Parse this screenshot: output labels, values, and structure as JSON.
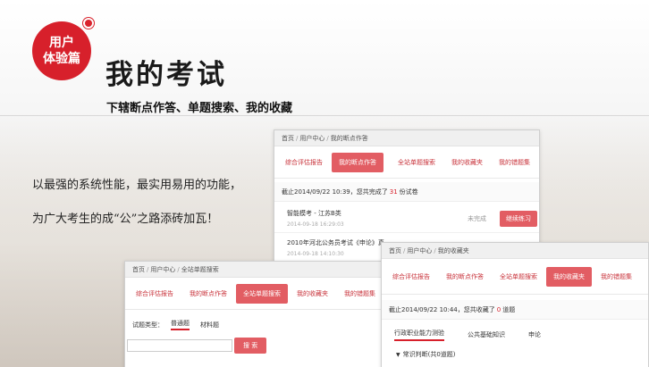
{
  "header": {
    "badge_line1": "用户",
    "badge_line2": "体验篇",
    "title": "我的考试",
    "subtitle": "下辖断点作答、单题搜索、我的收藏"
  },
  "slogan": {
    "line1": "以最强的系统性能，最实用易用的功能，",
    "line2": "为广大考生的成“公”之路添砖加瓦！"
  },
  "panel_breakpoint": {
    "breadcrumb": [
      "首页",
      "用户中心",
      "我的断点作答"
    ],
    "tabs": [
      "综合评估报告",
      "我的断点作答",
      "全站单题搜索",
      "我的收藏夹",
      "我的错题集"
    ],
    "active_tab": 1,
    "summary_prefix": "截止2014/09/22 10:39，您共完成了",
    "summary_count": "31",
    "summary_suffix": "份试卷",
    "exams": [
      {
        "name": "智能模考 - 江苏B类",
        "date": "2014-09-18 16:29:03",
        "status": "未完成",
        "action": "继续练习"
      },
      {
        "name": "2010年河北公务员考试《申论》真",
        "date": "2014-09-18 14:10:30",
        "status": "",
        "action": ""
      }
    ]
  },
  "panel_search": {
    "breadcrumb": [
      "首页",
      "用户中心",
      "全站单题搜索"
    ],
    "tabs": [
      "综合评估报告",
      "我的断点作答",
      "全站单题搜索",
      "我的收藏夹",
      "我的错题集"
    ],
    "active_tab": 2,
    "type_label": "试题类型：",
    "type_options": [
      "普通题",
      "材料题"
    ],
    "search_button": "搜 索"
  },
  "panel_favorites": {
    "breadcrumb": [
      "首页",
      "用户中心",
      "我的收藏夹"
    ],
    "tabs": [
      "综合评估报告",
      "我的断点作答",
      "全站单题搜索",
      "我的收藏夹",
      "我的错题集"
    ],
    "active_tab": 3,
    "summary_prefix": "截止2014/09/22 10:44，您共收藏了",
    "summary_count": "0",
    "summary_suffix": "道题",
    "subtabs": [
      "行政职业能力测验",
      "公共基础知识",
      "申论"
    ],
    "category": "常识判断(共0道题)"
  },
  "colors": {
    "accent": "#d7202b",
    "tab_active": "#e25d63"
  }
}
